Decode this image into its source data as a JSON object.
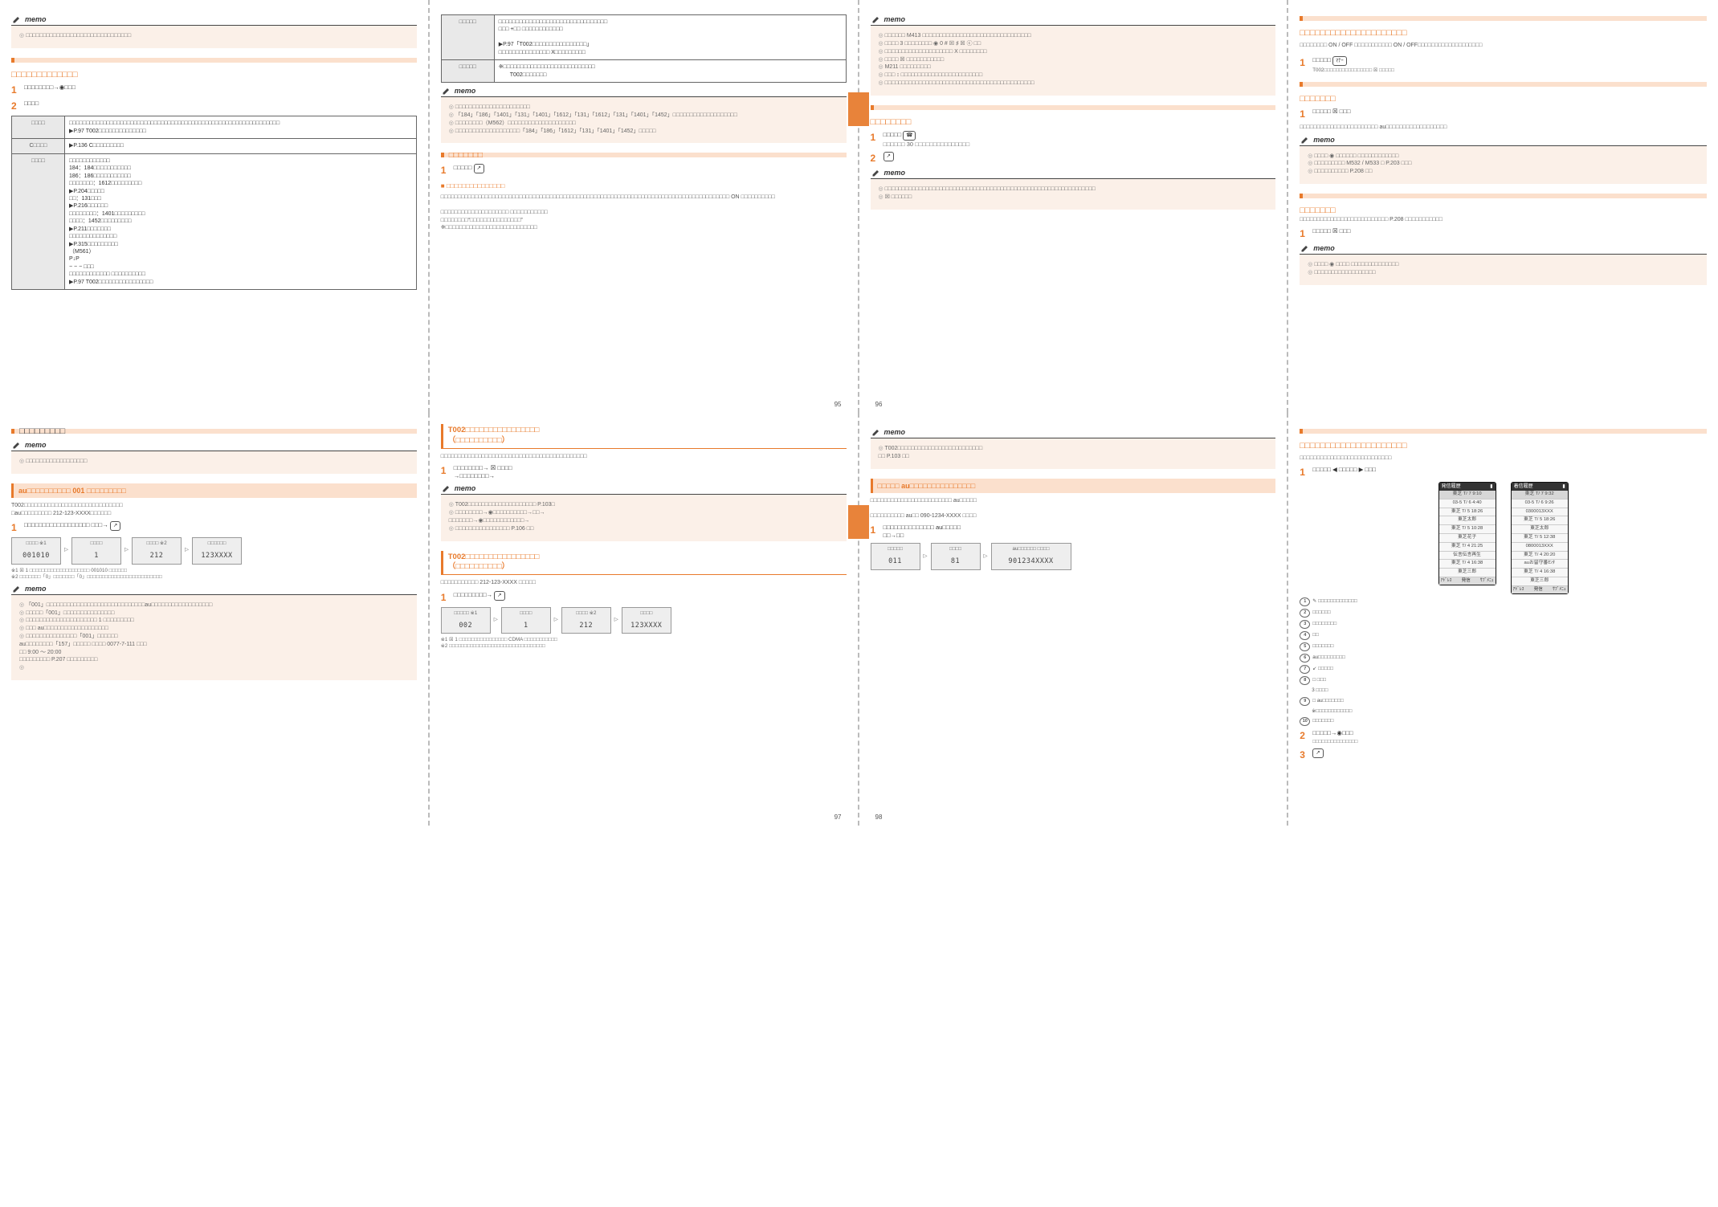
{
  "memo_label": "memo",
  "page_labels": {
    "p95": "95",
    "p96": "96",
    "p97": "97",
    "p98": "98"
  },
  "p95": {
    "memo1_lines": [
      "□□□□□□□□□□□□□□□□□□□□□□□□□□□□□□□"
    ],
    "sec1_title": "□□□□□□□□□□□□□",
    "step1": "□□□□□□□□→◉□□□",
    "step2_lead": "□□□□",
    "table": {
      "r1h": "□□□□",
      "r1": "□□□□□□□□□□□□□□□□□□□□□□□□□□□□□□□□□□□□□□□□□□□□□□□□□□□□□□□□□□□□□□\n▶P.97 T002□□□□□□□□□□□□□□",
      "r2h": "C□□□□",
      "r2": "▶P.136 C□□□□□□□□□",
      "r3h": "□□□□",
      "r3": "□□□□□□□□□□□□\n184：184□□□□□□□□□□□\n186：186□□□□□□□□□□□\n□□□□□□□：1612□□□□□□□□□\n▶P.204□□□□□\n□□：131□□□\n▶P.216□□□□□□\n□□□□□□□□：1401□□□□□□□□□\n□□□□：1452□□□□□□□□□\n▶P.211□□□□□□□\n□□□□□□□□□□□□□□\n▶P.315□□□□□□□□□\n（M561）\nP↓P\n−   −  − □□□\n□□□□□□□□□□□□ □□□□□□□□□□\n▶P.97 T002□□□□□□□□□□□□□□□□"
    }
  },
  "p95b": {
    "tophead_l": "□□□□□",
    "tophead_r": "□□□□□",
    "topbody_l": "□□□□□□□□□□□□□□□□□□□□□□□□□□□□□□□□\n□□□ +□□ □□□□□□□□□□□□\n\n▶P.97「T002□□□□□□□□□□□□□□□□」\n□□□□□□□□□□□□□□□ X□□□□□□□□□",
    "topbody_r": "※□□□□□□□□□□□□□□□□□□□□□□□□□□□\n　　T002□□□□□□□",
    "memo2_lines": [
      "□□□□□□□□□□□□□□□□□□□□□□",
      "「184」「186」「1401」「131」「1401」「1612」「131」「1612」「131」「1401」「1452」□□□□□□□□□□□□□□□□□□□",
      "□□□□□□□□（M562）□□□□□□□□□□□□□□□□□□□□",
      "□□□□□□□□□□□□□□□□□□□「184」「186」「1612」「131」「1401」「1452」□□□□□"
    ],
    "sec_title": "□□□□□□□",
    "step1": "□□□□□",
    "sub_title": "□□□□□□□□□□□□□□□",
    "body": "□□□□□□□□□□□□□□□□□□□□□□□□□□□□□□□□□□□□□□□□□□□□□□□□□□□□□□□□□□□□□□□□□□□□□□□□□□□□□□□□□□□□□ ON □□□□□□□□□□\n\n□□□□□□□□□□□□□□□□□□□□ □□□□□□□□□□□\n□□□□□□□□“□□□□□□□□□□□□□□□”\n※□□□□□□□□□□□□□□□□□□□□□□□□□□□"
  },
  "p96": {
    "memo1": [
      "□□□□□□ M413 □□□□□□□□□□□□□□□□□□□□□□□□□□□□□□□□",
      "□□□□ 3 □□□□□□□□ ◉ 0 # ☒ ♯ ☒ ⓒ □□",
      "□□□□□□□□□□□□□□□□□□□□ X □□□□□□□□",
      "□□□□ ☒ □□□□□□□□□□□",
      "M211 □□□□□□□□□",
      "□□□ ↕ □□□□□□□□□□□□□□□□□□□□□□□□",
      "□□□□□□□□□□□□□□□□□□□□□□□□□□□□□□□□□□□□□□□□□□□□"
    ],
    "sec_title": "□□□□□□□□",
    "step1": "□□□□□",
    "step1b": "□□□□□□ 30 □□□□□□□□□□□□□□□",
    "step2": "",
    "memo2": [
      "□□□□□□□□□□□□□□□□□□□□□□□□□□□□□□□□□□□□□□□□□□□□□□□□□□□□□□□□□□□□□□",
      "☒ □□□□□□"
    ]
  },
  "p96b": {
    "title": "□□□□□□□□□□□□□□□□□□□□□",
    "body1": "□□□□□□□□ ON / OFF □□□□□□□□□□□ ON / OFF□□□□□□□□□□□□□□□□□□□",
    "step1": "□□□□□",
    "step1_note": "T002□□□□□□□□□□□□□□□□ ☒ □□□□□",
    "sec2": "□□□□□□□",
    "step2": "□□□□□ ☒ □□□",
    "body2": "□□□□□□□□□□□□□□□□□□□□□□□ au□□□□□□□□□□□□□□□□□□",
    "memo1": [
      "□□□□ ◉ □□□□□□ □□□□□□□□□□□□",
      "□□□□□□□□□ M532 / M533 □ P.203 □□□",
      "□□□□□□□□□□ P.208 □□"
    ],
    "sec3": "□□□□□□□",
    "body3": "□□□□□□□□□□□□□□□□□□□□□□□□□□ P.208 □□□□□□□□□□□",
    "step3": "□□□□□ ☒ □□□",
    "memo2": [
      "□□□□ ◉ □□□□ □□□□□□□□□□□□□□",
      "□□□□□□□□□□□□□□□□□□"
    ]
  },
  "p97": {
    "sec_title": "□□□□□□□□□",
    "memo1": [
      "□□□□□□□□□□□□□□□□□□"
    ],
    "band_title": "au□□□□□□□□□□ 001 □□□□□□□□□",
    "body": "T002□□□□□□□□□□□□□□□□□□□□□□□□□□□□□\n□au□□□□□□□□□ 212-123-XXXX□□□□□□",
    "step1": "□□□□□□□□□□□□□□□□□□ □□□→",
    "cards": [
      {
        "lbl": "□□□□ ※1",
        "val": "001010"
      },
      {
        "lbl": "□□□□",
        "val": "1"
      },
      {
        "lbl": "□□□□ ※2",
        "val": "212"
      },
      {
        "lbl": "□□□□□□",
        "val": "123XXXX"
      }
    ],
    "notes": "※1 ☒ 1 □□□□□□□□□□□□□□□□□□□□ 001010 □□□□□□\n※2 □□□□□□□「0」□□□□□□□「0」□□□□□□□□□□□□□□□□□□□□□□□□□",
    "memo2": [
      "「001」□□□□□□□□□□□□□□□□□□□□□□□□□□□□□au□□□□□□□□□□□□□□□□□□",
      "□□□□□「001」□□□□□□□□□□□□□□□",
      "□□□□□□□□□□□□□□□□□□□□□ 1 □□□□□□□□□",
      "□□□ au□□□□□□□□□□□□□□□□□□□",
      "□□□□□□□□□□□□□□□「001」□□□□□□",
      "au□□□□□□□□「157」□□□□□    □□□□ 0077-7-111  □□□",
      "□□ 9:00 〜 20:00",
      "□□□□□□□□□ P.207 □□□□□□□□□"
    ]
  },
  "p97b": {
    "h1": "T002□□□□□□□□□□□□□□□□\n（□□□□□□□□□□）",
    "body1": "□□□□□□□□□□□□□□□□□□□□□□□□□□□□□□□□□□□□□□□□□□□",
    "step1": "□□□□□□□□→ ☒ □□□□\n→□□□□□□□□→",
    "memo1": [
      "T002□□□□□□□□□□□□□□□□□□□□ P.103□",
      "□□□□□□□□→◉□□□□□□□□□□→□□→",
      "□□□□□□□→◉□□□□□□□□□□□□→",
      "□□□□□□□□□□□□□□□□ P.106 □□"
    ],
    "h2": "T002□□□□□□□□□□□□□□□□\n（□□□□□□□□□□）",
    "body2": "□□□□□□□□□□□ 212-123-XXXX □□□□□",
    "step2": "□□□□□□□□□→",
    "cards": [
      {
        "lbl": "□□□□□ ※1",
        "val": "002"
      },
      {
        "lbl": "□□□□",
        "val": "1"
      },
      {
        "lbl": "□□□□ ※2",
        "val": "212"
      },
      {
        "lbl": "□□□□",
        "val": "123XXXX"
      }
    ],
    "notes": "※1 ☒ 1 □□□□□□□□□□□□□□□□ CDMA □□□□□□□□□□□\n※2 □□□□□□□□□□□□□□□□□□□□□□□□□□□□□□□□"
  },
  "p98": {
    "memo1": [
      "T002□□□□□□□□□□□□□□□□□□□□□□□□□",
      "□□ P.103 □□"
    ],
    "band_title": "□□□□□ au□□□□□□□□□□□□□□□",
    "body": "□□□□□□□□□□□□□□□□□□□□□□□□ au□□□□□\n\n□□□□□□□□□□ au□□ 090-1234-XXXX □□□□",
    "step1": "□□□□□□□□□□□□□□ au□□□□□\n□□→□□",
    "cards": [
      {
        "lbl": "□□□□□",
        "val": "011"
      },
      {
        "lbl": "□□□□",
        "val": "81"
      },
      {
        "lbl": "au□□□□□□ □□□□",
        "val": "901234XXXX"
      }
    ]
  },
  "p98b": {
    "title": "□□□□□□□□□□□□□□□□□□□□□",
    "body": "□□□□□□□□□□□□□□□□□□□□□□□□□□□",
    "step1": "□□□□□ ◀ □□□□□  ▶ □□□",
    "screenA": {
      "title": "発信履歴",
      "rows": [
        "東芝 T/ 7 9:10",
        "03-5 T/ 6 4:40",
        "東芝 T/ 5 18:26",
        "東芝太郎",
        "東芝 T/ 5 10:28",
        "東芝花子",
        "東芝 T/ 4 21:25",
        "伝言伝言再生",
        "東芝 T/ 4 16:38",
        "東芝三郎"
      ]
    },
    "screenB": {
      "title": "着信履歴",
      "rows": [
        "東芝 T/ 7 9:32",
        "03-5 T/ 6 9:26",
        "0300013XXX",
        "東芝 T/ 5 18:26",
        "東芝太郎",
        "東芝 T/ 5 12:38",
        "0800013XXX",
        "東芝 T/ 4 20:20",
        "auお留守番ｾﾝﾀ",
        "東芝 T/ 4 16:38",
        "東芝三郎"
      ]
    },
    "screen_footer": [
      "ｱﾄﾞﾚｽ",
      "発信",
      "ｻﾌﾞﾒﾆｭ"
    ],
    "callouts": [
      "✎ □□□□□□□□□□□□□",
      "□□□□□□",
      "□□□□□□□□",
      "□□",
      "□□□□□□□",
      "au□□□□□□□□□",
      "↙ □□□□□",
      "□ □□□",
      "3 □□□□",
      "□ au□□□□□□□",
      "※□□□□□□□□□□□□",
      "□□□□□□□"
    ],
    "step2": "□□□□□→◉□□□",
    "step2b": "□□□□□□□□□□□□□□□",
    "step3": ""
  }
}
